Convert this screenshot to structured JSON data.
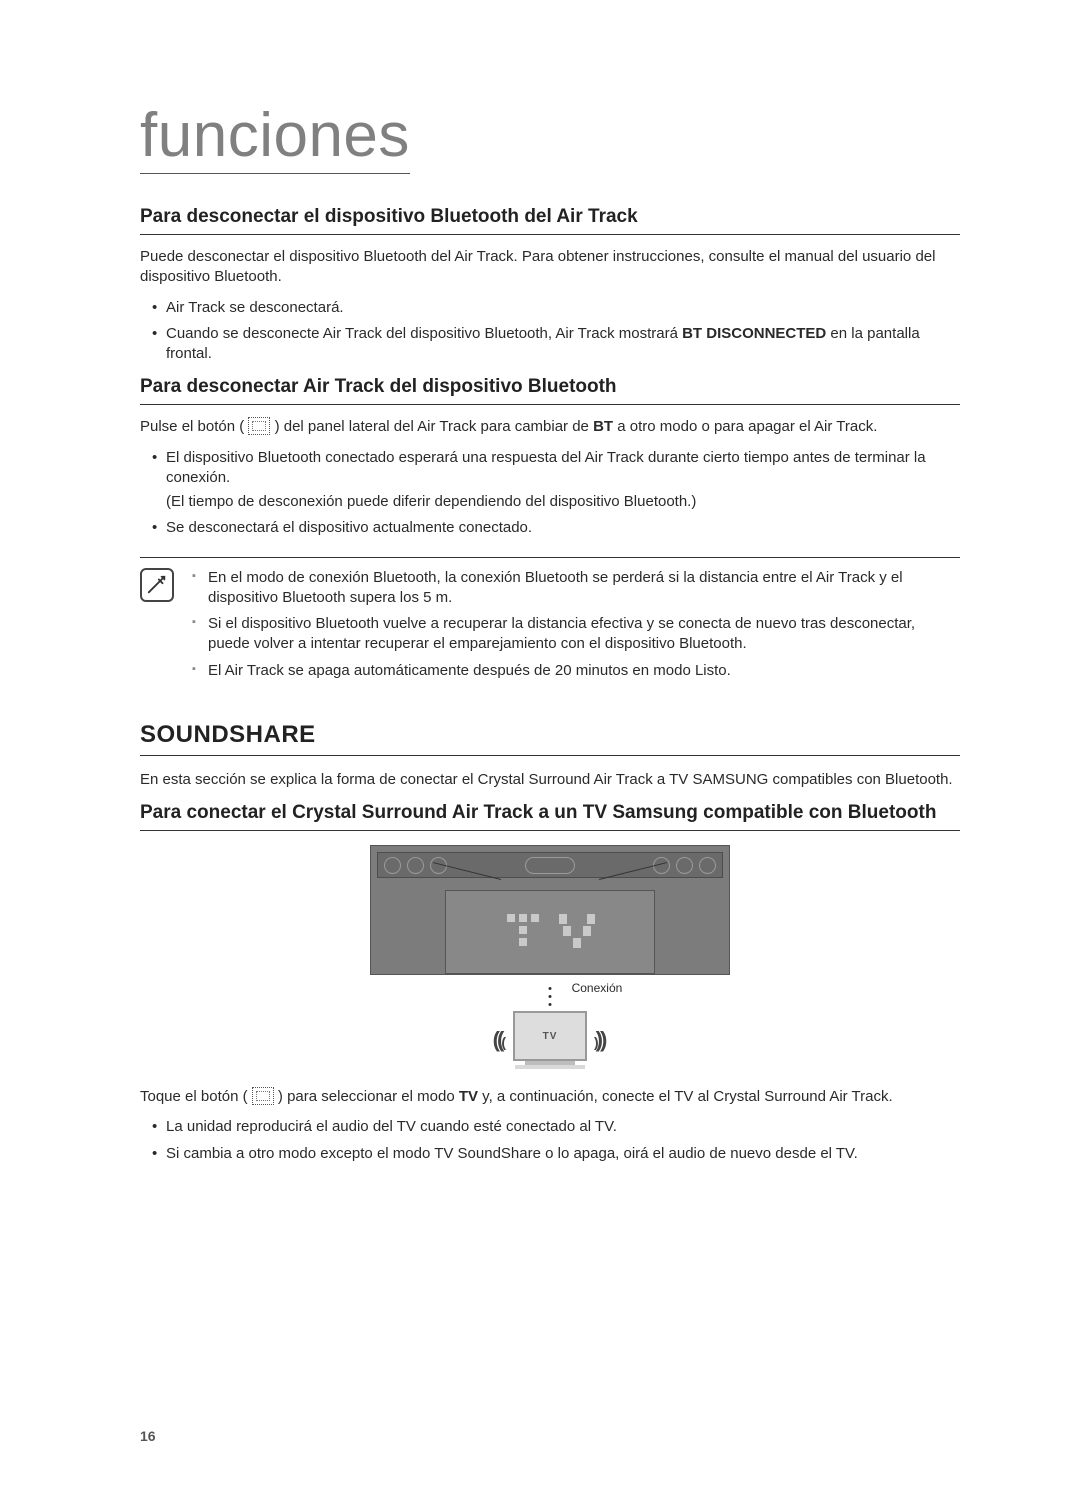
{
  "pageTitle": "funciones",
  "sec1": {
    "heading": "Para desconectar el dispositivo Bluetooth del Air Track",
    "intro": "Puede desconectar el dispositivo Bluetooth del Air Track. Para obtener instrucciones, consulte el manual del usuario del dispositivo Bluetooth.",
    "b1": "Air Track se desconectará.",
    "b2_pre": "Cuando se desconecte Air Track del dispositivo Bluetooth, Air Track mostrará ",
    "b2_bold": "BT DISCONNECTED",
    "b2_post": " en la pantalla frontal."
  },
  "sec2": {
    "heading": "Para desconectar Air Track del dispositivo Bluetooth",
    "p_pre": "Pulse el botón ( ",
    "p_mid": " ) del panel lateral del Air Track para cambiar de ",
    "p_bold": "BT",
    "p_post": " a otro modo o para apagar el Air Track.",
    "b1": "El dispositivo Bluetooth conectado esperará una respuesta del Air Track durante cierto tiempo antes de terminar la conexión.",
    "b1_sub": "(El tiempo de desconexión puede diferir dependiendo del dispositivo Bluetooth.)",
    "b2": "Se desconectará el dispositivo actualmente conectado."
  },
  "notes": {
    "n1": "En el modo de conexión Bluetooth, la conexión Bluetooth se perderá si la distancia entre el Air Track y el dispositivo Bluetooth supera los 5 m.",
    "n2": "Si el dispositivo Bluetooth vuelve a recuperar la distancia efectiva y se conecta de nuevo tras desconectar, puede volver a intentar recuperar el emparejamiento con el dispositivo Bluetooth.",
    "n3": "El Air Track se apaga automáticamente después de 20 minutos en modo Listo."
  },
  "soundshare": {
    "title": "SOUNDSHARE",
    "intro": "En esta sección se explica la forma de conectar el Crystal Surround Air Track a TV SAMSUNG compatibles con Bluetooth.",
    "subheading": "Para conectar el Crystal Surround Air Track a un TV Samsung compatible con Bluetooth",
    "conn_label": "Conexión",
    "tv_label": "TV",
    "p2_pre": "Toque el botón ( ",
    "p2_mid": " ) para seleccionar el modo ",
    "p2_bold": "TV",
    "p2_post": " y, a continuación, conecte el TV al Crystal Surround Air Track.",
    "b1": "La unidad reproducirá el audio del TV cuando esté conectado al TV.",
    "b2": "Si cambia a otro modo excepto el modo TV SoundShare o lo apaga, oirá el audio de nuevo desde el TV."
  },
  "pageNumber": "16"
}
